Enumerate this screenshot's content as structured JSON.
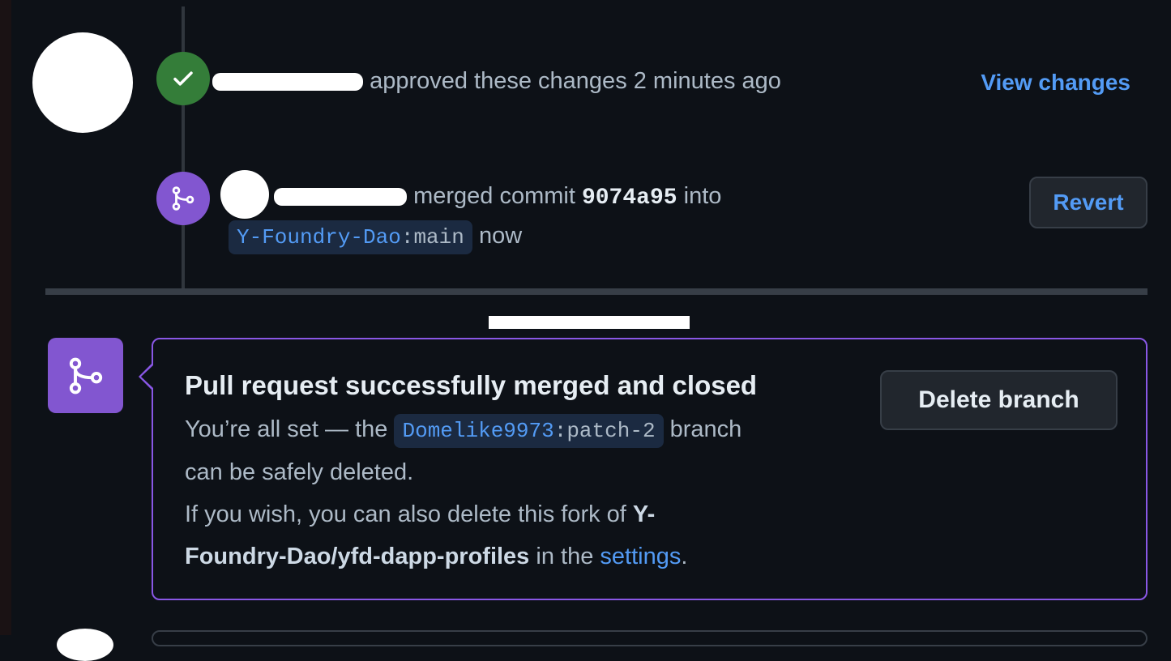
{
  "approval": {
    "action_text": "approved these changes 2 minutes ago",
    "view_changes": "View changes"
  },
  "merge_event": {
    "merged_text": "merged commit",
    "commit_sha": "9074a95",
    "into_text": "into",
    "branch_owner": "Y-Foundry-Dao",
    "branch_sep": ":",
    "branch_name": "main",
    "time_text": "now",
    "revert_label": "Revert"
  },
  "merged_card": {
    "title": "Pull request successfully merged and closed",
    "line1_prefix": "You’re all set — the",
    "head_owner": "Domelike9973",
    "head_sep": ":",
    "head_branch": "patch-2",
    "line1_suffix": "branch",
    "line2": "can be safely deleted.",
    "line3_prefix": "If you wish, you can also delete this fork of",
    "repo_part1": "Y-",
    "repo_part2": "Foundry-Dao/yfd-dapp-profiles",
    "line4_mid": "in the",
    "settings_link": "settings",
    "line4_end": ".",
    "delete_branch_label": "Delete branch"
  },
  "colors": {
    "background": "#0d1117",
    "approved_green": "#347d39",
    "merged_purple": "#8256d0",
    "link_blue": "#539bf5"
  },
  "icons": {
    "approved": "check-icon",
    "merged": "git-merge-icon"
  }
}
